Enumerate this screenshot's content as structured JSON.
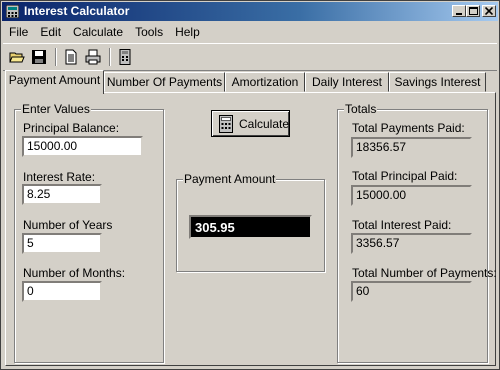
{
  "window": {
    "title": "Interest Calculator"
  },
  "menu": [
    "File",
    "Edit",
    "Calculate",
    "Tools",
    "Help"
  ],
  "toolbar": {
    "icons": [
      "open-folder-icon",
      "save-icon",
      "document-icon",
      "print-icon",
      "calculator-icon"
    ]
  },
  "tabs": [
    "Payment Amount",
    "Number Of Payments",
    "Amortization",
    "Daily Interest",
    "Savings Interest"
  ],
  "active_tab": "Payment Amount",
  "enter_values": {
    "legend": "Enter Values",
    "principal_label": "Principal Balance:",
    "principal_value": "15000.00",
    "rate_label": "Interest Rate:",
    "rate_value": "8.25",
    "years_label": "Number of Years",
    "years_value": "5",
    "months_label": "Number of Months:",
    "months_value": "0"
  },
  "calculate_button": {
    "label": "Calculate"
  },
  "payment": {
    "legend": "Payment Amount",
    "value": "305.95"
  },
  "totals": {
    "legend": "Totals",
    "payments_label": "Total Payments Paid:",
    "payments_value": "18356.57",
    "principal_label": "Total Principal Paid:",
    "principal_value": "15000.00",
    "interest_label": "Total Interest Paid:",
    "interest_value": "3356.57",
    "num_payments_label": "Total Number of Payments:",
    "num_payments_value": "60"
  },
  "colors": {
    "title_start": "#0a246a",
    "title_end": "#a6caf0",
    "face": "#d4d0c8",
    "result_bg": "#000000"
  }
}
